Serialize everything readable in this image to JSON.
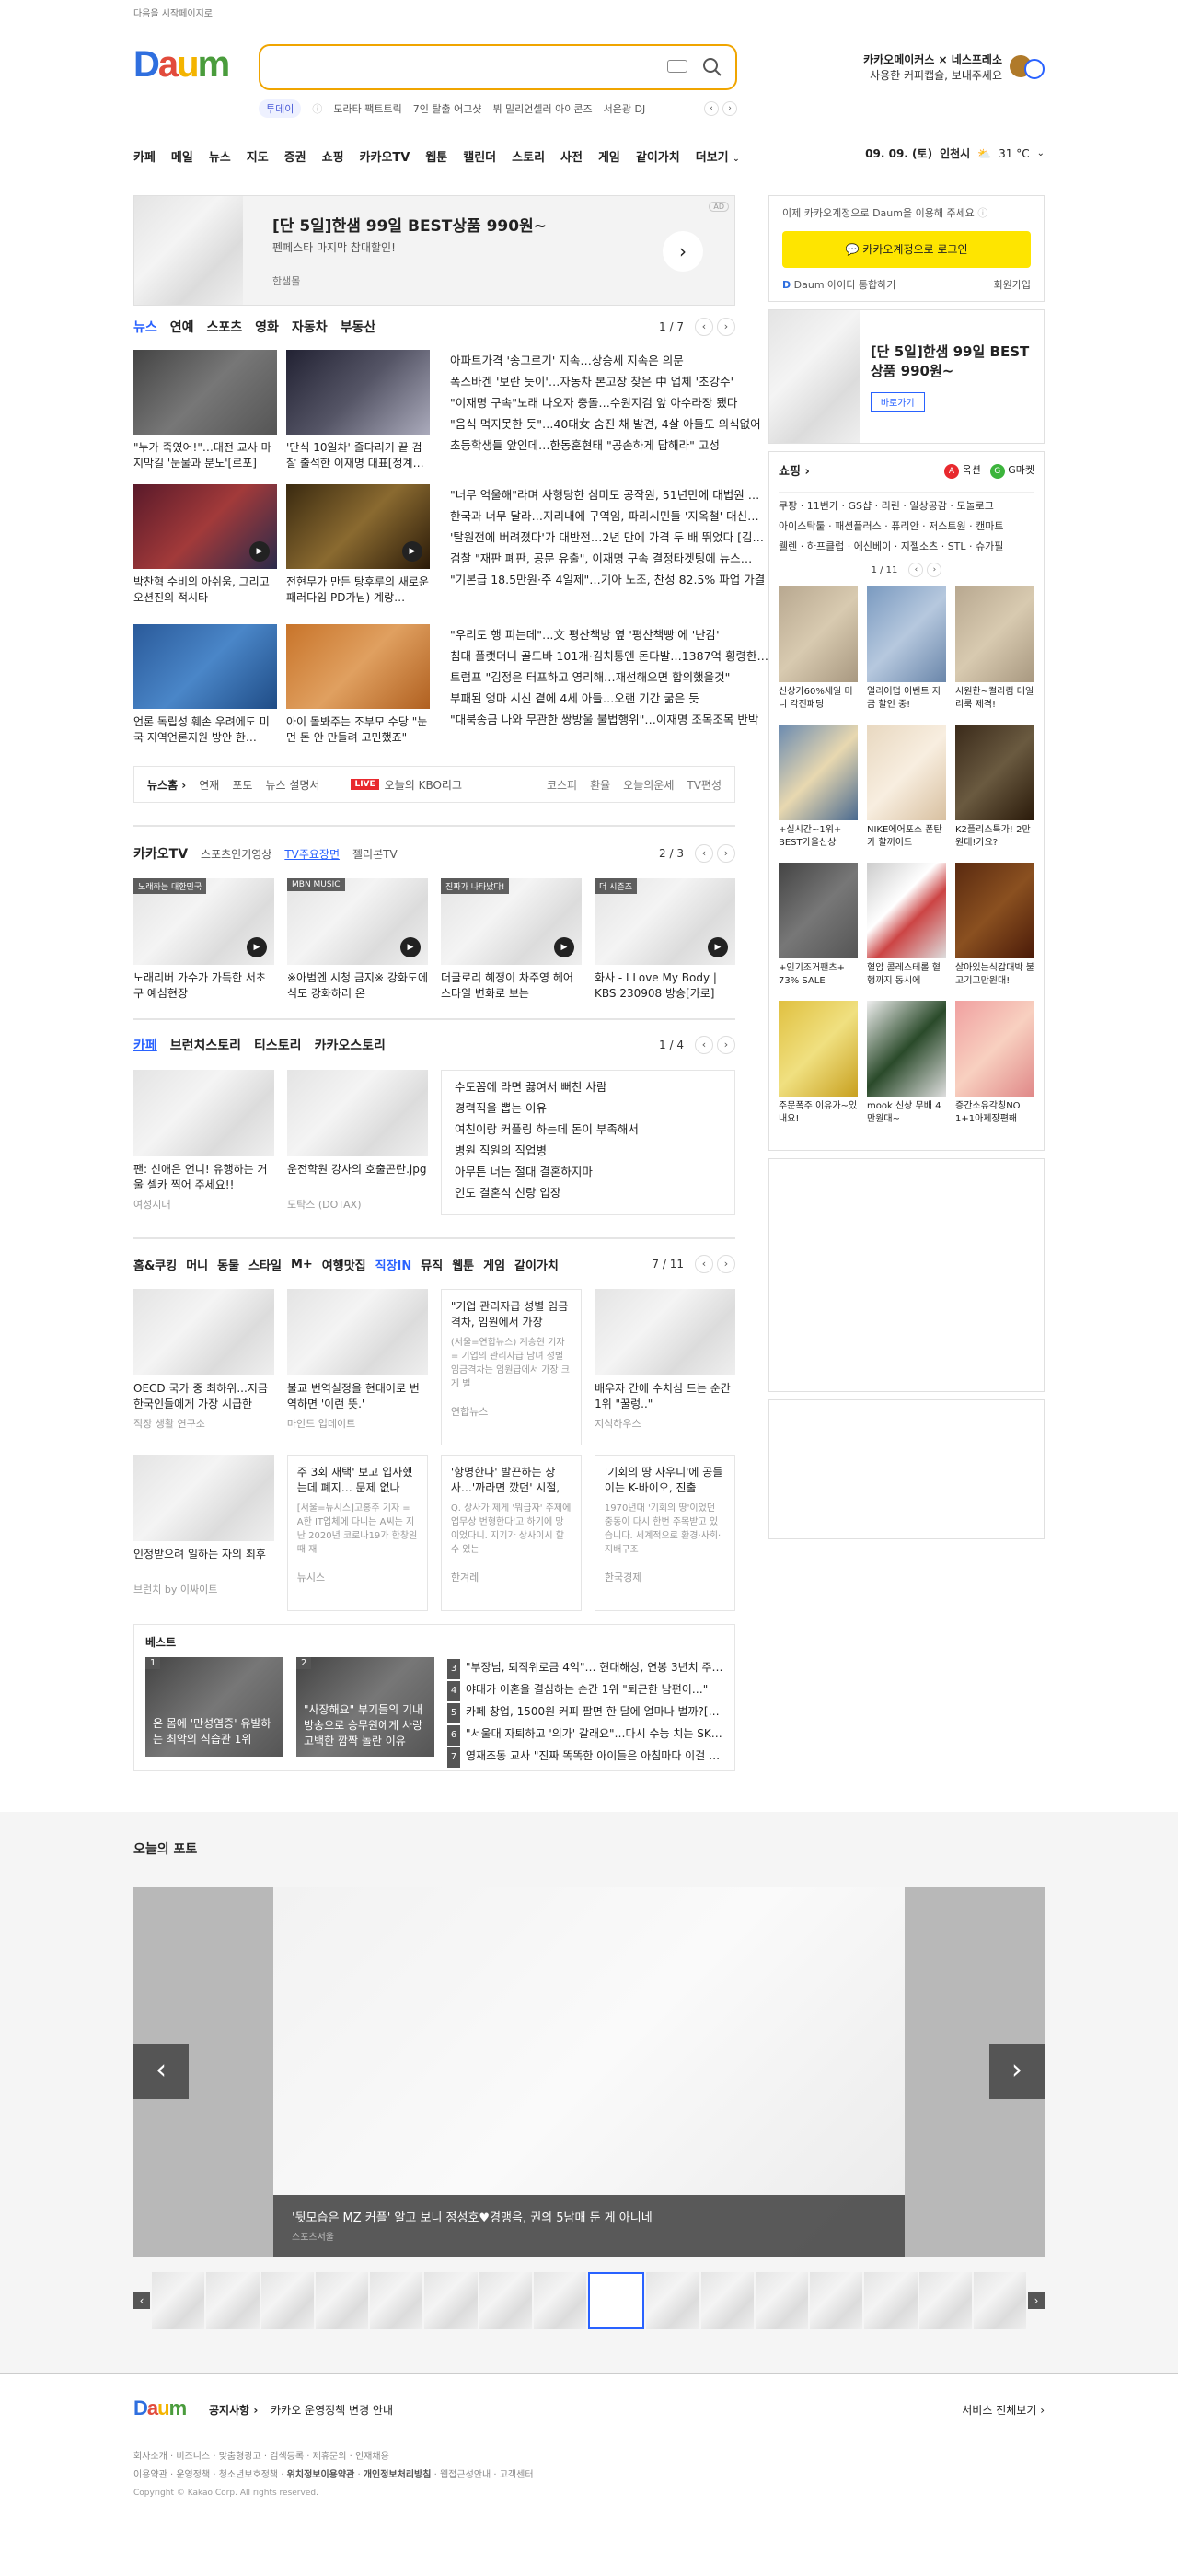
{
  "top_link": "다음을 시작페이지로",
  "logo": "Daum",
  "search": {
    "placeholder": ""
  },
  "trend": {
    "badge": "투데이",
    "items": [
      "모라타 팩트트릭",
      "7인 탈출 어그샷",
      "뷔 밀리언셀러 아이콘즈",
      "서은광 DJ"
    ]
  },
  "promo_top": {
    "line1": "카카오메이커스 × 네스프레소",
    "line2": "사용한 커피캡슐, 보내주세요"
  },
  "gnb": [
    "카페",
    "메일",
    "뉴스",
    "지도",
    "증권",
    "쇼핑",
    "카카오TV",
    "웹툰",
    "캘린더",
    "스토리",
    "사전",
    "게임",
    "같이가치",
    "더보기"
  ],
  "weather": {
    "date": "09. 09. (토)",
    "place": "인천시",
    "temp": "31 °C"
  },
  "ad_banner": {
    "title": "[단 5일]한샘 99일 BEST상품 990원~",
    "sub": "펜페스타 마지막 참대할인!",
    "brand": "한샘몰",
    "ad": "AD"
  },
  "news": {
    "tabs": [
      "뉴스",
      "연예",
      "스포츠",
      "영화",
      "자동차",
      "부동산"
    ],
    "page": "1 / 7",
    "thumbs": [
      {
        "cap": "\"누가 죽였어!\"…대전 교사 마지막길 '눈물과 분노'[르포]"
      },
      {
        "cap": "'단식 10일차' 줄다리기 끝 검찰 출석한 이재명 대표[정계…"
      },
      {
        "cap": "박찬혁 수비의 아쉬움, 그리고 오션진의 적시타"
      },
      {
        "cap": "전현무가 만든 탕후루의 새로운 패러다임 PD가님) 계랑…"
      },
      {
        "cap": "언론 독립성 훼손 우려에도 미국 지역언론지원 방안 한…"
      },
      {
        "cap": "아이 돌봐주는 조부모 수당 \"눈먼 돈 안 만들려 고민했죠\""
      }
    ],
    "list1": [
      "아파트가격 '송고르기' 지속…상승세 지속은 의문",
      "폭스바겐 '보란 듯이'…자동차 본고장 찾은 中 업체 '초강수'",
      "\"이재명 구속\"노래 나오자 충돌…수원지검 앞 아수라장 됐다",
      "\"음식 먹지못한 듯\"…40대女 숨진 채 발견, 4살 아들도 의식없어",
      "초등학생들 앞인데…한동훈현태 \"공손하게 답해라\" 고성"
    ],
    "list2": [
      "\"너무 억울해\"라며 사형당한 심미도 공작원, 51년만에 대법원 …",
      "한국과 너무 달라…지리내에 구역임, 파리시민들 '지옥철' 대신…",
      "'탈원전에 버려졌다'가 대반전…2년 만에 가격 두 배 뛰었다 [김…",
      "검찰 \"재판 폐판, 공문 유출\", 이재명 구속 결정타겟팅에 뉴스…",
      "\"기본급 18.5만원·주 4일제\"…기아 노조, 찬성 82.5% 파업 가결"
    ],
    "list3": [
      "\"우리도 행 피는데\"…文 평산책방 옆 '평산책빵'에 '난감'",
      "침대 플랫더니 골드바 101개·김치통엔 돈다발…1387억 횡령한…",
      "트럼프 \"김정은 터프하고 영리해…재선해으면 합의했을것\"",
      "부패된 엉마 시신 곁에 4세 아들…오랜 기간 굶은 듯",
      "\"대북송금 나와 무관한 쌍방울 불법행위\"…이재명 조목조목 반박"
    ],
    "footer_left": [
      "뉴스홈",
      "연재",
      "포토",
      "뉴스 설명서"
    ],
    "live": "LIVE",
    "live_text": "오늘의 KBO리그",
    "footer_right": [
      "코스피",
      "환율",
      "오늘의운세",
      "TV편성"
    ]
  },
  "kakaotv": {
    "title": "카카오TV",
    "tabs": [
      "스포츠인기영상",
      "TV주요장면",
      "젤리본TV"
    ],
    "page": "2 / 3",
    "items": [
      {
        "tag": "노래하는 대한민국",
        "cap": "노래리버 가수가 가득한 서초구 예심현장"
      },
      {
        "tag": "MBN MUSIC",
        "cap": "※아범엔 시청 금지※ 강화도에 식도 강화하러 온"
      },
      {
        "tag": "진짜가 나타났다!",
        "cap": "더글로리 혜정이 차주영 헤어스타일 변화로 보는"
      },
      {
        "tag": "더 시즌즈",
        "cap": "화사 - I Love My Body | KBS 230908 방송[가로]"
      }
    ]
  },
  "cafe": {
    "tabs": [
      "카페",
      "브런치스토리",
      "티스토리",
      "카카오스토리"
    ],
    "page": "1 / 4",
    "items": [
      {
        "cap": "팬: 신애은 언니! 유행하는 거울 셀카 찍어 주세요!!",
        "src": "여성시대"
      },
      {
        "cap": "운전학원 강사의 호출곤란.jpg",
        "src": "도탁스 (DOTAX)"
      }
    ],
    "list": [
      "수도꼼에 라면 끓여서 뻐친 사람",
      "경력직을 뽑는 이유",
      "여친이랑 커플링 하는데 돈이 부족해서",
      "병원 직원의 직업병",
      "아무튼 너는 절대 결혼하지마",
      "인도 결혼식 신랑 입장"
    ]
  },
  "life": {
    "tabs": [
      "홈&쿠킹",
      "머니",
      "동물",
      "스타일",
      "M+",
      "여행맛집",
      "직장IN",
      "뮤직",
      "웹툰",
      "게임",
      "같이가치"
    ],
    "page": "7 / 11",
    "row1": [
      {
        "cap": "OECD 국가 중 최하위...지금 한국인들에게 가장 시급한",
        "src": "직장 생활 연구소"
      },
      {
        "cap": "불교 번역실정을 현대어로 번역하면 '이런 뜻.'",
        "src": "마인드 업데이트"
      },
      {
        "title": "\"기업 관리자급 성별 임금 격차, 임원에서 가장",
        "body": "(서울=연합뉴스) 계승현 기자 = 기업의 관리자급 남녀 성별 임금격차는 임원급에서 가장 크게 벌",
        "src": "연합뉴스"
      },
      {
        "cap": "배우자 간에 수치심 드는 순간 1위 \"꿀렁..\"",
        "src": "지식하우스"
      }
    ],
    "row2": [
      {
        "cap": "인정받으려 일하는 자의 최후",
        "src": "브런치 by 이싸이트"
      },
      {
        "title": "주 3회 재택' 보고 입사했는데 폐지… 문제 없나",
        "body": "[서울=뉴시스]고홍주 기자 = A한 IT업체에 다니는 A씨는 지난 2020년 코로나19가 한창일 때 재",
        "src": "뉴시스"
      },
      {
        "title": "'항명한다' 발끈하는 상사…'까라면 깠던' 시절,",
        "body": "Q. 상사가 제게 '뭐급자' 주제에 업무상 번형한다'고 하기에 망이었다니. 지기가 상사이시 할 수 있는",
        "src": "한겨레"
      },
      {
        "title": "'기회의 땅 사우디'에 공들이는 K-바이오, 진출",
        "body": "1970년대 '기회의 땅'이었던 중동이 다시 한번 주목받고 있습니다. 세계적으로 환경·사회·지배구조",
        "src": "한국경제"
      }
    ],
    "best_title": "베스트",
    "best_cards": [
      {
        "num": "1",
        "cap": "온 몸에 '만성염증' 유발하는 최악의 식습관 1위"
      },
      {
        "num": "2",
        "cap": "\"사장해요\" 부기들의 기내방송으로 승무원에게 사랑고백한 깜짝 놀란 이유"
      }
    ],
    "best_list": [
      {
        "num": "3",
        "t": "\"부장님, 퇴직위로금 4억\"… 현대해상, 연봉 3년치 주…"
      },
      {
        "num": "4",
        "t": "야대가 이혼을 결심하는 순간 1위 \"퇴근한 남편이…\""
      },
      {
        "num": "5",
        "t": "카페 창업, 1500원 커피 팔면 한 달에 얼마나 벌까?[…"
      },
      {
        "num": "6",
        "t": "\"서울대 자퇴하고 '의가' 갈래요\"…다시 수능 치는 SK…"
      },
      {
        "num": "7",
        "t": "영재조동 교사 \"진짜 똑똑한 아이들은 아침마다 이걸 …"
      }
    ]
  },
  "side": {
    "login_msg": "이제 카카오계정으로 Daum을 이용해 주세요",
    "login_btn": "카카오계정으로 로그인",
    "id_link": "Daum 아이디 통합하기",
    "join": "회원가입",
    "ad_title": "[단 5일]한샘 99일 BEST상품 990원~",
    "ad_btn": "바로가기",
    "shop_title": "쇼핑",
    "shop_brands": [
      "옥션",
      "G마켓"
    ],
    "shop_tags": [
      "쿠팡",
      "11번가",
      "GS샵",
      "리린",
      "일상공감",
      "모놀로그",
      "아이스탁툴",
      "패션플러스",
      "퓨리안",
      "저스트원",
      "캔마트",
      "웰렌",
      "하프클럽",
      "에신베이",
      "지젤소츠",
      "STL",
      "슈가필"
    ],
    "shop_page": "1 / 11",
    "products": [
      {
        "cap": "신상가60%세일 미니 각진패딩"
      },
      {
        "cap": "얼리어덥 이벤트 지금 할인 중!"
      },
      {
        "cap": "시원한~컬리컴 데일리룩 제격!"
      },
      {
        "cap": "+실시간~1위+ BEST가을신상"
      },
      {
        "cap": "NIKE에어포스 폰탄카 할꺼이드"
      },
      {
        "cap": "K2플리스특가! 2만원대!가요?"
      },
      {
        "cap": "+인기조거팬츠+ 73% SALE"
      },
      {
        "cap": "혈압 콜레스테롤 혈행까지 동시에"
      },
      {
        "cap": "살아있는식감대박 불고기고만원대!"
      },
      {
        "cap": "주문폭주 이유가~있내요!"
      },
      {
        "cap": "mook 신상 무배 4만원대~"
      },
      {
        "cap": "증간소유각칭NO 1+1아제장편해"
      }
    ]
  },
  "photo": {
    "title": "오늘의 포토",
    "caption": "'뒷모습은 MZ 커플' 알고 보니 정성호♥경맹음, 권의 5남매 둔 게 아니네",
    "source": "스포츠서울"
  },
  "footer": {
    "notice_label": "공지사항",
    "notice": "카카오 운영정책 변경 안내",
    "all_services": "서비스 전체보기",
    "links1": [
      "회사소개",
      "비즈니스",
      "맞춤형광고",
      "검색등록",
      "제휴문의",
      "인재채용"
    ],
    "links2": [
      "이용약관",
      "운영정책",
      "청소년보호정책",
      "위치정보이용약관",
      "개인정보처리방침",
      "웹접근성안내",
      "고객센터"
    ],
    "copyright": "Copyright © Kakao Corp. All rights reserved."
  },
  "colors": {
    "accent": "#2962ff",
    "kakao": "#fee500",
    "live": "#e8292e"
  }
}
